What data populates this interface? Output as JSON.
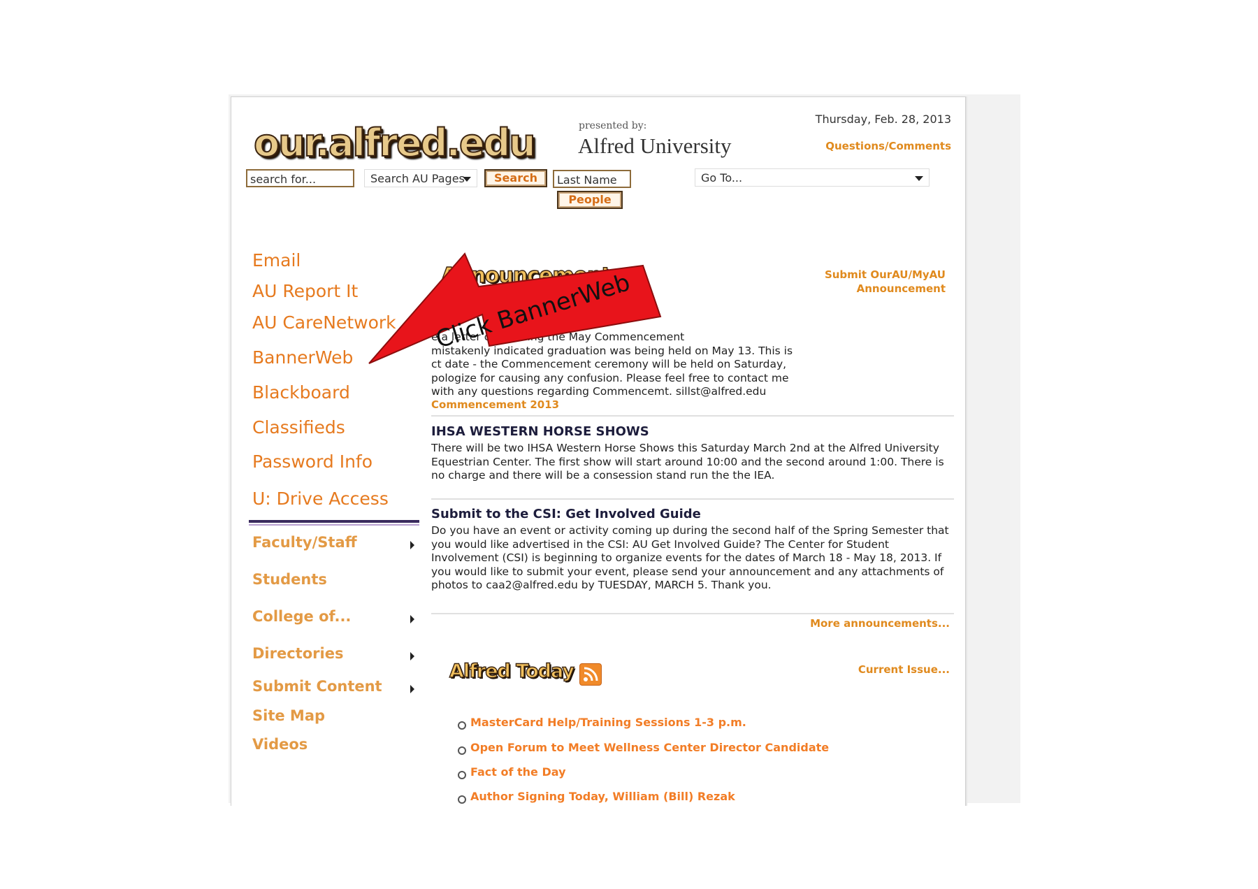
{
  "header": {
    "logo_text": "our.alfred.edu",
    "presented_by": "presented by:",
    "university": "Alfred University",
    "date": "Thursday, Feb. 28, 2013",
    "questions_link": "Questions/Comments"
  },
  "search": {
    "input_value": "search for...",
    "scope_select": "Search AU Pages",
    "search_button": "Search",
    "people_input_value": "Last Name",
    "people_button": "People",
    "goto_select": "Go To..."
  },
  "leftnav": {
    "primary": [
      "Email",
      "AU Report It",
      "AU CareNetwork",
      "BannerWeb",
      "Blackboard",
      "Classifieds",
      "Password Info",
      "U: Drive Access"
    ],
    "secondary": [
      "Faculty/Staff",
      "Students",
      "College of...",
      "Directories",
      "Submit Content",
      "Site Map",
      "Videos"
    ]
  },
  "announcements": {
    "title": "Announcements",
    "submit_link_line1": "Submit OurAU/MyAU",
    "submit_link_line2": "Announcement",
    "item1_text": "e a letter concerning the May Commencement\nmistakenly indicated graduation was being held on May 13. This is\nct date - the Commencement ceremony will be held on Saturday,\npologize for causing any confusion. Please feel free to contact me\nwith any questions regarding Commencemt. sillst@alfred.edu",
    "item1_link": "Commencement 2013",
    "item2_title": "IHSA WESTERN HORSE SHOWS",
    "item2_text": "There will be two IHSA Western Horse Shows this Saturday March 2nd at the Alfred University Equestrian Center. The first show will start around 10:00 and the second around 1:00. There is no charge and there will be a consession stand run the the IEA.",
    "item3_title": "Submit to the CSI: Get Involved Guide",
    "item3_text": "Do you have an event or activity coming up during the second half of the Spring Semester that you would like advertised in the CSI: AU Get Involved Guide? The Center for Student Involvement (CSI) is beginning to organize events for the dates of March 18 - May 18, 2013. If you would like to submit your event, please send your announcement and any attachments of photos to caa2@alfred.edu by TUESDAY, MARCH 5. Thank you.",
    "more_link": "More announcements..."
  },
  "alfred_today": {
    "title": "Alfred Today",
    "current_issue": "Current Issue...",
    "items": [
      "MasterCard Help/Training Sessions 1-3 p.m.",
      "Open Forum to Meet Wellness Center Director Candidate",
      "Fact of the Day",
      "Author Signing Today, William (Bill) Rezak"
    ]
  },
  "callout": {
    "text": "Click BannerWeb",
    "color": "#e8141b"
  }
}
